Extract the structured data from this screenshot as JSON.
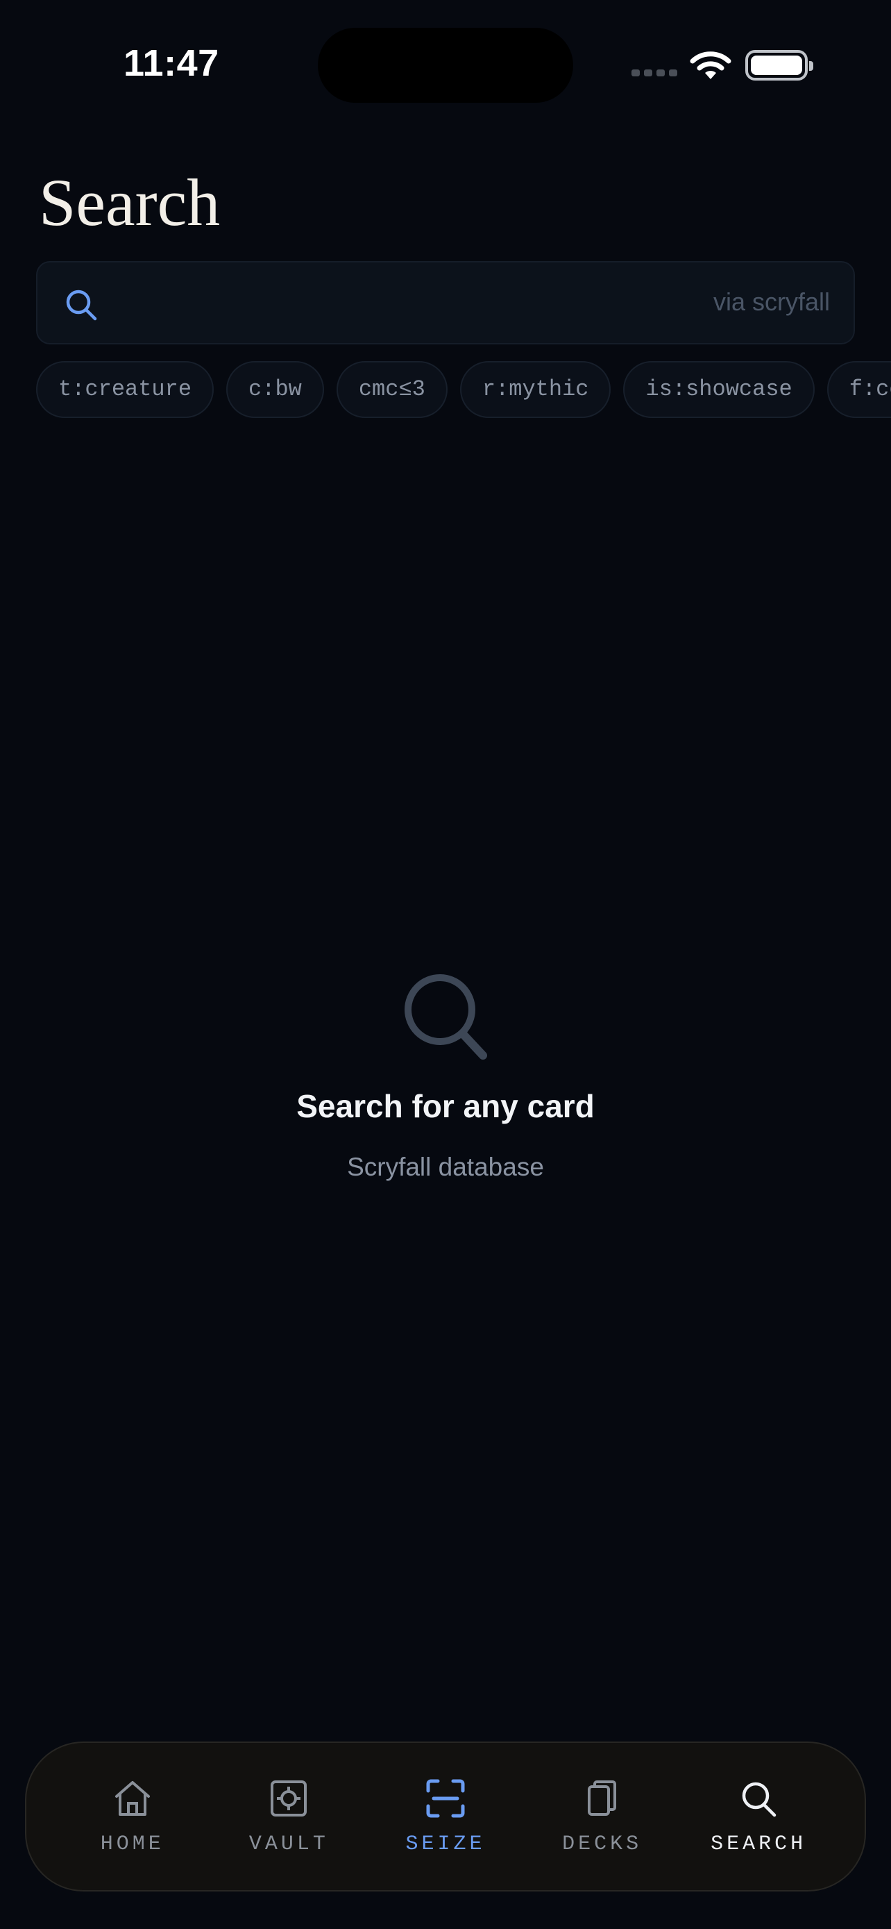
{
  "status_bar": {
    "time": "11:47"
  },
  "page": {
    "title": "Search"
  },
  "search": {
    "placeholder": "",
    "hint": "via scryfall"
  },
  "filter_chips": [
    "t:creature",
    "c:bw",
    "cmc≤3",
    "r:mythic",
    "is:showcase",
    "f:commander"
  ],
  "empty_state": {
    "icon": "search-icon",
    "title": "Search for any card",
    "subtitle": "Scryfall database"
  },
  "tab_bar": {
    "items": [
      {
        "label": "HOME",
        "icon": "home-icon"
      },
      {
        "label": "VAULT",
        "icon": "vault-icon"
      },
      {
        "label": "SEIZE",
        "icon": "scan-icon",
        "state": "accent"
      },
      {
        "label": "DECKS",
        "icon": "decks-icon"
      },
      {
        "label": "SEARCH",
        "icon": "search-icon",
        "state": "selected"
      }
    ]
  },
  "colors": {
    "background": "#060910",
    "accent": "#6a9cf2",
    "muted_text": "#8a93a2",
    "tab_bar_bg": "#12110f"
  }
}
